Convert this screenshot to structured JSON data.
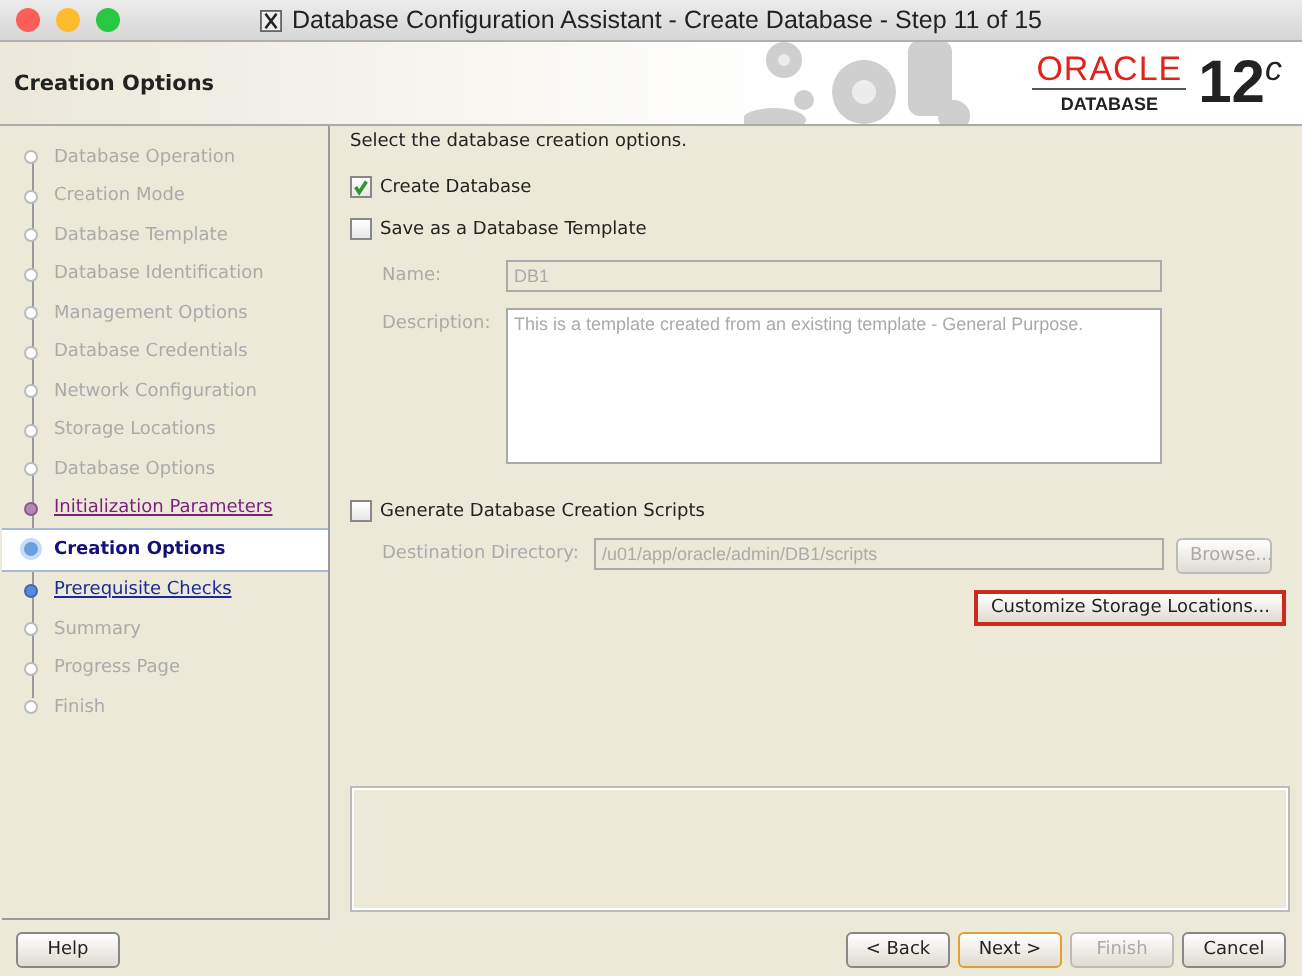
{
  "window": {
    "title": "Database Configuration Assistant - Create Database - Step 11 of 15"
  },
  "header": {
    "title": "Creation Options",
    "logo": {
      "brand": "ORACLE",
      "product": "DATABASE",
      "version": "12$^{c}$"
    }
  },
  "steps": [
    {
      "label": "Database Operation",
      "enabled": false,
      "visited": false,
      "selected": false
    },
    {
      "label": "Creation Mode",
      "enabled": false,
      "visited": false,
      "selected": false
    },
    {
      "label": "Database Template",
      "enabled": false,
      "visited": false,
      "selected": false
    },
    {
      "label": "Database Identification",
      "enabled": false,
      "visited": false,
      "selected": false
    },
    {
      "label": "Management Options",
      "enabled": false,
      "visited": false,
      "selected": false
    },
    {
      "label": "Database Credentials",
      "enabled": false,
      "visited": false,
      "selected": false
    },
    {
      "label": "Network Configuration",
      "enabled": false,
      "visited": false,
      "selected": false
    },
    {
      "label": "Storage Locations",
      "enabled": false,
      "visited": false,
      "selected": false
    },
    {
      "label": "Database Options",
      "enabled": false,
      "visited": false,
      "selected": false
    },
    {
      "label": "Initialization Parameters",
      "enabled": true,
      "visited": true,
      "selected": false
    },
    {
      "label": "Creation Options",
      "enabled": true,
      "visited": false,
      "selected": true
    },
    {
      "label": "Prerequisite Checks",
      "enabled": true,
      "visited": false,
      "selected": false
    },
    {
      "label": "Summary",
      "enabled": false,
      "visited": false,
      "selected": false
    },
    {
      "label": "Progress Page",
      "enabled": false,
      "visited": false,
      "selected": false
    },
    {
      "label": "Finish",
      "enabled": false,
      "visited": false,
      "selected": false
    }
  ],
  "content": {
    "instruction": "Select the database creation options.",
    "create_database": {
      "label": "Create Database",
      "checked": true
    },
    "save_template": {
      "label": "Save as a Database Template",
      "checked": false
    },
    "name": {
      "label": "Name:",
      "value": "DB1",
      "disabled": true
    },
    "description": {
      "label": "Description:",
      "value": "This is a template created from an existing template - General Purpose.",
      "disabled": true
    },
    "generate_scripts": {
      "label": "Generate Database Creation Scripts",
      "checked": false
    },
    "destination": {
      "label": "Destination Directory:",
      "value": "/u01/app/oracle/admin/DB1/scripts",
      "disabled": true
    },
    "browse_button": {
      "label": "Browse...",
      "disabled": true
    },
    "customize_button": {
      "label": "Customize Storage Locations...",
      "focused": true
    }
  },
  "buttons": [
    {
      "label": "Help",
      "kind": "normal",
      "disabled": false
    },
    {
      "label": "< Back",
      "kind": "normal",
      "disabled": false
    },
    {
      "label": "Next >",
      "kind": "default",
      "disabled": false
    },
    {
      "label": "Finish",
      "kind": "normal",
      "disabled": true
    },
    {
      "label": "Cancel",
      "kind": "normal",
      "disabled": false
    }
  ]
}
